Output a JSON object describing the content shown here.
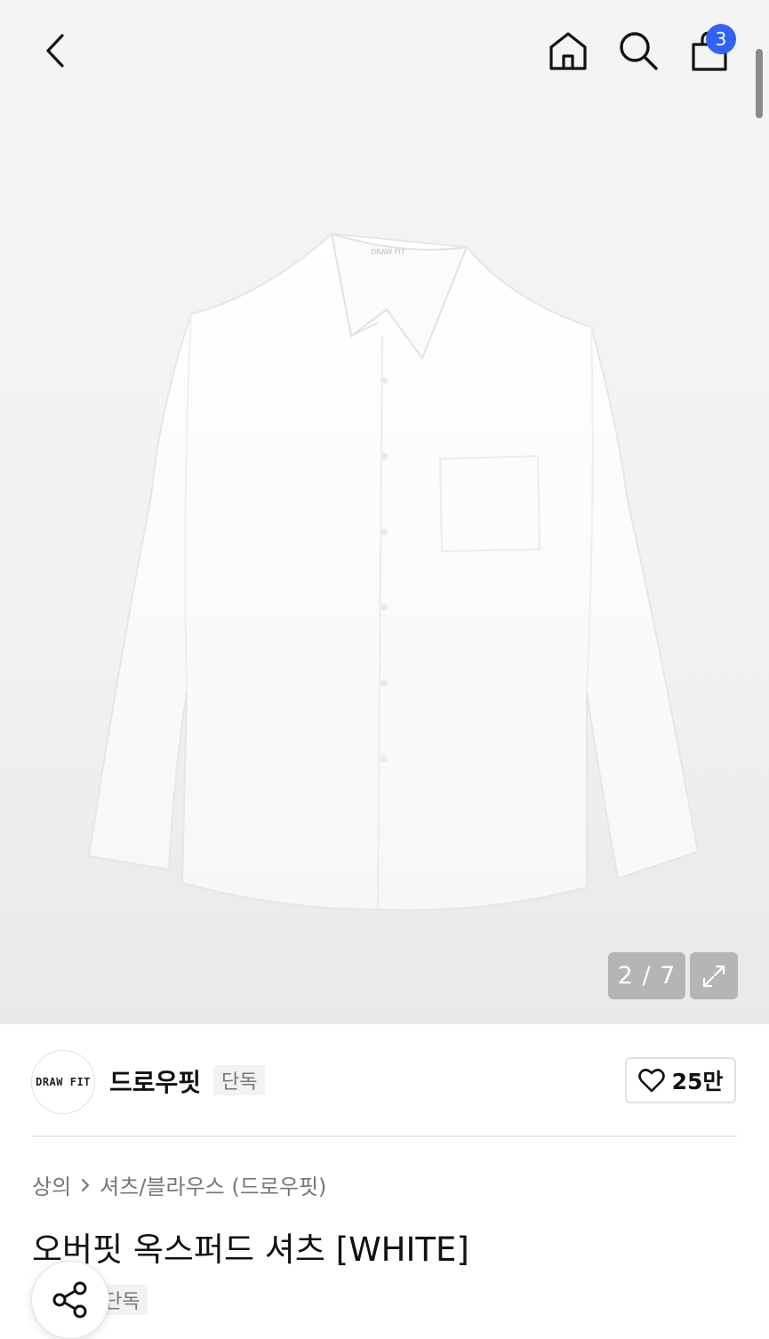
{
  "header": {
    "back_icon": "chevron-left-icon",
    "home_icon": "home-icon",
    "search_icon": "search-icon",
    "cart_icon": "shopping-bag-icon",
    "cart_count": "3"
  },
  "gallery": {
    "counter": "2 / 7",
    "expand_icon": "expand-icon",
    "image_label": "DRAW FIT"
  },
  "brand": {
    "logo_text": "DRAW FIT",
    "name": "드로우핏",
    "exclusive_tag": "단독",
    "like_icon": "heart-icon",
    "like_count": "25만"
  },
  "product": {
    "breadcrumb": [
      "상의",
      "셔츠/블라우스 (드로우핏)"
    ],
    "title": "오버핏 옥스퍼드 셔츠 [WHITE]",
    "exclusive_tag": "단독"
  },
  "share": {
    "icon": "share-icon"
  },
  "colors": {
    "accent": "#2f62f5",
    "badge_bg": "#b5b5b5"
  }
}
